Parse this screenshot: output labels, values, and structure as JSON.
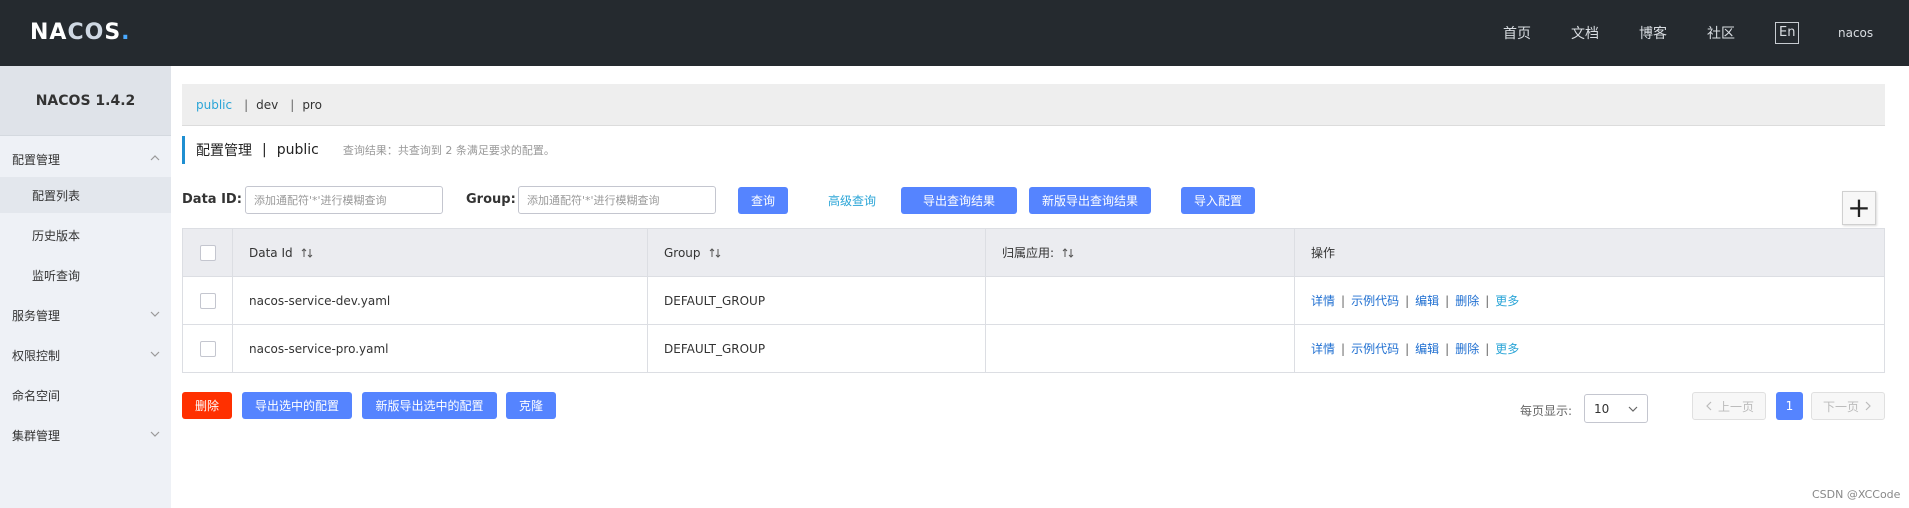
{
  "header": {
    "logo": "NACOS.",
    "logo_parts": [
      "NA",
      "CO",
      "S",
      "."
    ],
    "nav": [
      "首页",
      "文档",
      "博客",
      "社区"
    ],
    "lang": "En",
    "user": "nacos"
  },
  "sidebar": {
    "version": "NACOS 1.4.2",
    "items": [
      {
        "label": "配置管理",
        "expanded": true
      },
      {
        "label": "配置列表",
        "sub": true,
        "active": true
      },
      {
        "label": "历史版本",
        "sub": true
      },
      {
        "label": "监听查询",
        "sub": true
      },
      {
        "label": "服务管理",
        "expanded": false
      },
      {
        "label": "权限控制",
        "expanded": false
      },
      {
        "label": "命名空间"
      },
      {
        "label": "集群管理",
        "expanded": false
      }
    ]
  },
  "namespaces": [
    "public",
    "dev",
    "pro"
  ],
  "title": {
    "main": "配置管理",
    "separator": "|",
    "namespace": "public",
    "hint": "查询结果：共查询到 2 条满足要求的配置。"
  },
  "search": {
    "data_id_label": "Data ID:",
    "data_id_placeholder": "添加通配符'*'进行模糊查询",
    "group_label": "Group:",
    "group_placeholder": "添加通配符'*'进行模糊查询",
    "query": "查询",
    "advanced": "高级查询",
    "export_results": "导出查询结果",
    "new_export_results": "新版导出查询结果",
    "import": "导入配置",
    "add": "+"
  },
  "table": {
    "columns": [
      "Data Id",
      "Group",
      "归属应用:",
      "操作"
    ],
    "rows": [
      {
        "data_id": "nacos-service-dev.yaml",
        "group": "DEFAULT_GROUP",
        "app": ""
      },
      {
        "data_id": "nacos-service-pro.yaml",
        "group": "DEFAULT_GROUP",
        "app": ""
      }
    ],
    "operations": [
      "详情",
      "示例代码",
      "编辑",
      "删除",
      "更多"
    ]
  },
  "bottom": {
    "delete": "删除",
    "export_selected": "导出选中的配置",
    "new_export_selected": "新版导出选中的配置",
    "clone": "克隆",
    "page_size_label": "每页显示:",
    "page_size": "10",
    "prev": "上一页",
    "current_page": "1",
    "next": "下一页"
  },
  "watermark": "CSDN @XCCode",
  "colors": {
    "topbar": "#252a2f",
    "primary": "#5584ff",
    "danger": "#ff3000",
    "link": "#2ba5d7",
    "accent_bar": "#1f8fd1"
  }
}
